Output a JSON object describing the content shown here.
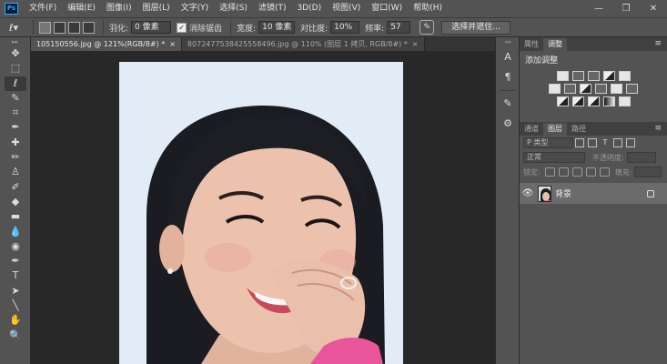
{
  "app": {
    "logo": "Ps"
  },
  "menubar": {
    "items": [
      "文件(F)",
      "编辑(E)",
      "图像(I)",
      "图层(L)",
      "文字(Y)",
      "选择(S)",
      "滤镜(T)",
      "3D(D)",
      "视图(V)",
      "窗口(W)",
      "帮助(H)"
    ],
    "minimize": "—",
    "restore": "❐",
    "close": "✕"
  },
  "options": {
    "feather_label": "羽化:",
    "feather_value": "0 像素",
    "antialias_label": "消除锯齿",
    "antialias_checked": true,
    "width_label": "宽度:",
    "width_value": "10 像素",
    "contrast_label": "对比度:",
    "contrast_value": "10%",
    "frequency_label": "频率:",
    "frequency_value": "57",
    "select_mask_button": "选择并遮住..."
  },
  "doc_tabs": [
    {
      "label": "105150556.jpg @ 121%(RGB/8#) *",
      "close": "×",
      "active": true
    },
    {
      "label": "8072477538425558496.jpg @ 110% (图层 1 拷贝, RGB/8#) *",
      "close": "×",
      "active": false
    }
  ],
  "toolbar": {
    "grip": "▸▸",
    "tools": [
      {
        "name": "move-tool",
        "glyph": "✥"
      },
      {
        "name": "marquee-tool",
        "glyph": "⬚"
      },
      {
        "name": "magnetic-lasso-tool",
        "glyph": "ℓ",
        "active": true
      },
      {
        "name": "quick-selection-tool",
        "glyph": "✎"
      },
      {
        "name": "crop-tool",
        "glyph": "⌗"
      },
      {
        "name": "eyedropper-tool",
        "glyph": "✒"
      },
      {
        "name": "healing-brush-tool",
        "glyph": "✚"
      },
      {
        "name": "brush-tool",
        "glyph": "✏"
      },
      {
        "name": "clone-stamp-tool",
        "glyph": "♙"
      },
      {
        "name": "history-brush-tool",
        "glyph": "✐"
      },
      {
        "name": "eraser-tool",
        "glyph": "◆"
      },
      {
        "name": "gradient-tool",
        "glyph": "▬"
      },
      {
        "name": "blur-tool",
        "glyph": "💧"
      },
      {
        "name": "dodge-tool",
        "glyph": "◉"
      },
      {
        "name": "pen-tool",
        "glyph": "✒"
      },
      {
        "name": "type-tool",
        "glyph": "T"
      },
      {
        "name": "path-selection-tool",
        "glyph": "➤"
      },
      {
        "name": "line-tool",
        "glyph": "╲"
      },
      {
        "name": "hand-tool",
        "glyph": "✋"
      },
      {
        "name": "zoom-tool",
        "glyph": "🔍"
      }
    ]
  },
  "middock": {
    "grip": "◂◂",
    "icons": [
      {
        "name": "character-panel-icon",
        "glyph": "A"
      },
      {
        "name": "paragraph-panel-icon",
        "glyph": "¶"
      },
      {
        "name": "brush-settings-icon",
        "glyph": "✎"
      },
      {
        "name": "adjustments-panel-icon",
        "glyph": "⚙"
      }
    ]
  },
  "panels": {
    "top_tabs": [
      "属性",
      "调整"
    ],
    "top_active": 1,
    "menu_glyph": "≡",
    "add_adjustment": "添加调整",
    "layer_tabs": [
      "通道",
      "图层",
      "路径"
    ],
    "layer_active": 1,
    "filter_kind": "P 类型",
    "blend_mode": "正常",
    "opacity_label": "不透明度:",
    "lock_label": "锁定:",
    "fill_label": "填充:",
    "layer_name": "背景"
  }
}
